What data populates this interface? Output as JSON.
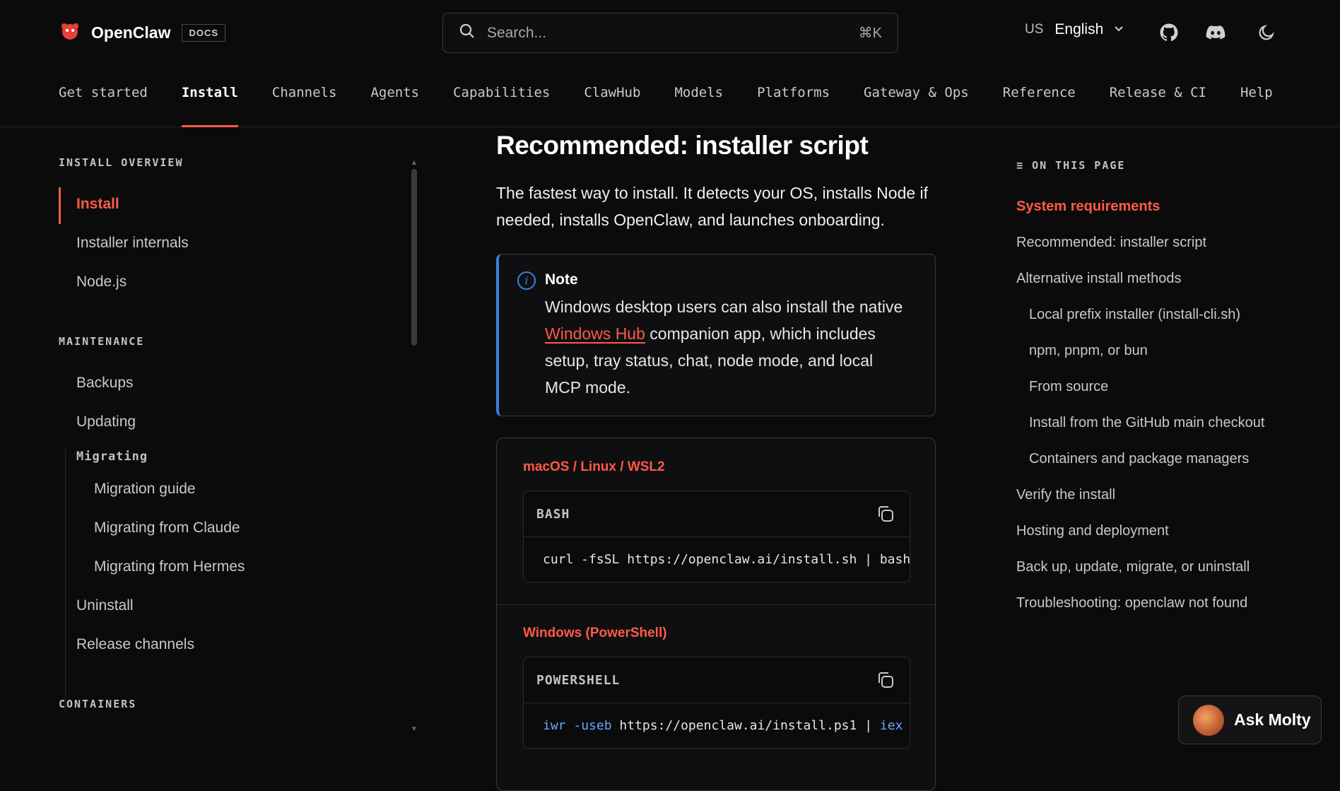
{
  "header": {
    "brand": "OpenClaw",
    "docs_badge": "DOCS",
    "search_placeholder": "Search...",
    "search_shortcut": "⌘K",
    "lang_code": "US",
    "lang_label": "English"
  },
  "nav": {
    "tabs": [
      "Get started",
      "Install",
      "Channels",
      "Agents",
      "Capabilities",
      "ClawHub",
      "Models",
      "Platforms",
      "Gateway & Ops",
      "Reference",
      "Release & CI",
      "Help"
    ],
    "active": "Install"
  },
  "sidebar": {
    "section_overview": "INSTALL OVERVIEW",
    "overview_items": [
      "Install",
      "Installer internals",
      "Node.js"
    ],
    "section_maintenance": "MAINTENANCE",
    "maintenance_items": [
      "Backups",
      "Updating"
    ],
    "migrating_heading": "Migrating",
    "migrating_items": [
      "Migration guide",
      "Migrating from Claude",
      "Migrating from Hermes"
    ],
    "maintenance_items_after": [
      "Uninstall",
      "Release channels"
    ],
    "section_containers": "CONTAINERS"
  },
  "main": {
    "heading": "Recommended: installer script",
    "intro": "The fastest way to install. It detects your OS, installs Node if needed, installs OpenClaw, and launches onboarding.",
    "note_title": "Note",
    "note_before": "Windows desktop users can also install the native ",
    "note_link": "Windows Hub",
    "note_after": " companion app, which includes setup, tray status, chat, node mode, and local MCP mode.",
    "os1": "macOS / Linux / WSL2",
    "block1_lang": "BASH",
    "block1_code": "curl -fsSL https://openclaw.ai/install.sh | bash",
    "os2": "Windows (PowerShell)",
    "block2_lang": "POWERSHELL",
    "block2_cmd": "iwr",
    "block2_flag": "-useb",
    "block2_url": "https://openclaw.ai/install.ps1",
    "block2_pipe": "|",
    "block2_end": "iex"
  },
  "toc": {
    "heading": "ON THIS PAGE",
    "items": [
      {
        "label": "System requirements",
        "indent": false,
        "active": true
      },
      {
        "label": "Recommended: installer script",
        "indent": false
      },
      {
        "label": "Alternative install methods",
        "indent": false
      },
      {
        "label": "Local prefix installer (install-cli.sh)",
        "indent": true
      },
      {
        "label": "npm, pnpm, or bun",
        "indent": true
      },
      {
        "label": "From source",
        "indent": true
      },
      {
        "label": "Install from the GitHub main checkout",
        "indent": true
      },
      {
        "label": "Containers and package managers",
        "indent": true
      },
      {
        "label": "Verify the install",
        "indent": false
      },
      {
        "label": "Hosting and deployment",
        "indent": false
      },
      {
        "label": "Back up, update, migrate, or uninstall",
        "indent": false
      },
      {
        "label": "Troubleshooting: openclaw not found",
        "indent": false
      }
    ]
  },
  "ask": {
    "label": "Ask Molty"
  },
  "colors": {
    "accent": "#ff5a45",
    "info": "#3d7ed8",
    "background": "#0b0b0c"
  },
  "icons": [
    "logo-icon",
    "search-icon",
    "chevron-down-icon",
    "github-icon",
    "discord-icon",
    "moon-icon",
    "info-icon",
    "copy-icon",
    "menu-lines-icon"
  ]
}
